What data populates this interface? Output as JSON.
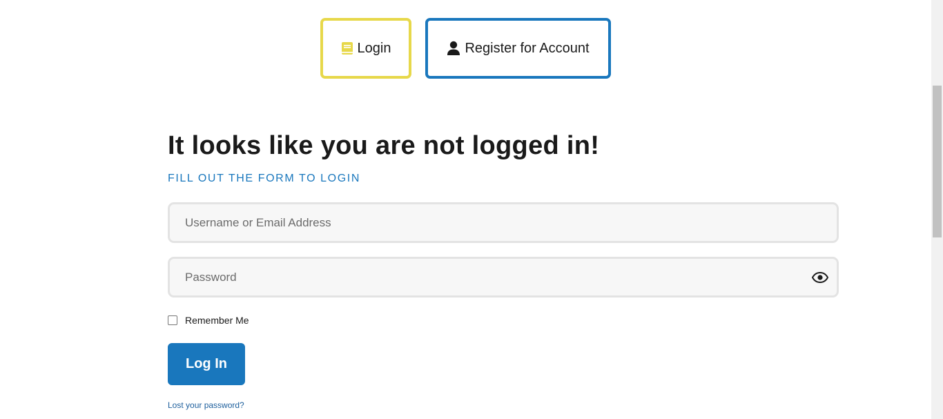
{
  "tabs": {
    "login_label": "Login",
    "login_icon": "book-icon",
    "login_border_color": "#e7d84a",
    "register_label": "Register for Account",
    "register_icon": "user-icon",
    "register_border_color": "#1977bd"
  },
  "main": {
    "heading": "It looks like you are not logged in!",
    "subheading": "FILL OUT THE FORM TO LOGIN"
  },
  "form": {
    "username_placeholder": "Username or Email Address",
    "username_value": "",
    "password_placeholder": "Password",
    "password_value": "",
    "password_toggle_icon": "eye-icon",
    "remember_label": "Remember Me",
    "remember_checked": false,
    "submit_label": "Log In",
    "lost_password_label": "Lost your password?"
  },
  "colors": {
    "accent": "#1977bd",
    "highlight": "#e7d84a"
  }
}
